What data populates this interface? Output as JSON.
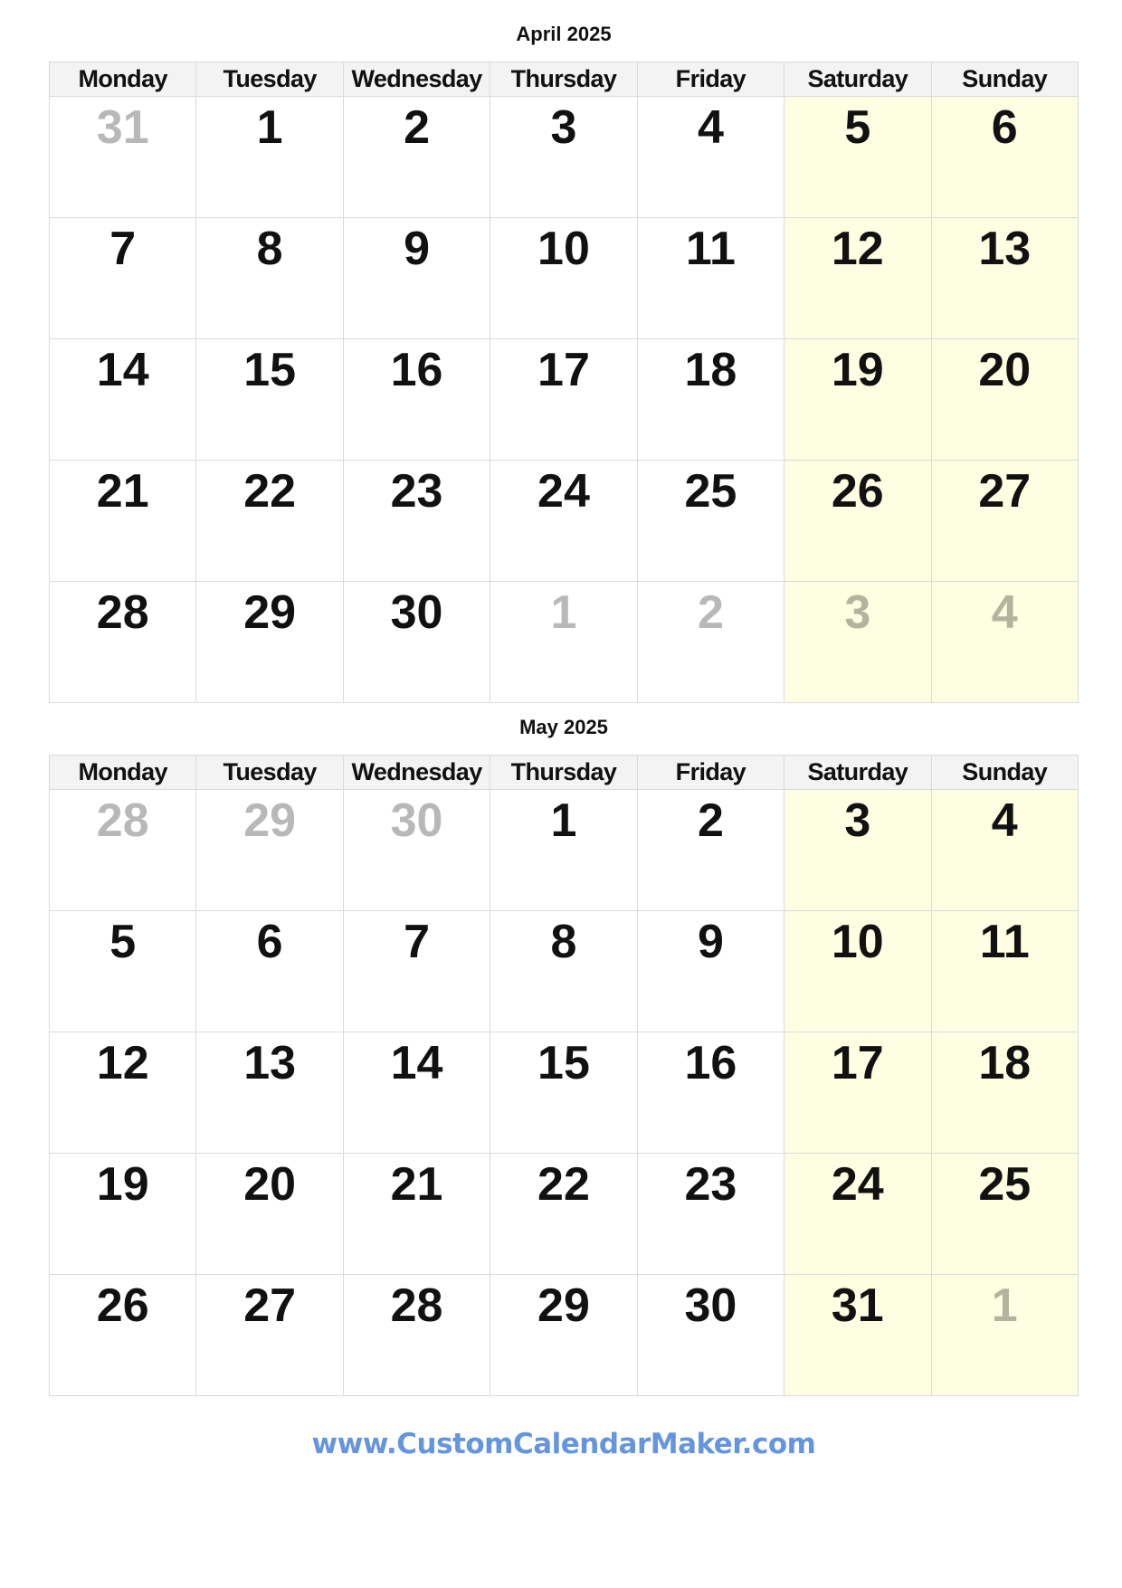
{
  "calendars": [
    {
      "title": "April 2025",
      "weekdays": [
        "Monday",
        "Tuesday",
        "Wednesday",
        "Thursday",
        "Friday",
        "Saturday",
        "Sunday"
      ],
      "weeks": [
        [
          {
            "day": "31",
            "other": true
          },
          {
            "day": "1"
          },
          {
            "day": "2"
          },
          {
            "day": "3"
          },
          {
            "day": "4"
          },
          {
            "day": "5"
          },
          {
            "day": "6"
          }
        ],
        [
          {
            "day": "7"
          },
          {
            "day": "8"
          },
          {
            "day": "9"
          },
          {
            "day": "10"
          },
          {
            "day": "11"
          },
          {
            "day": "12"
          },
          {
            "day": "13"
          }
        ],
        [
          {
            "day": "14"
          },
          {
            "day": "15"
          },
          {
            "day": "16"
          },
          {
            "day": "17"
          },
          {
            "day": "18"
          },
          {
            "day": "19"
          },
          {
            "day": "20"
          }
        ],
        [
          {
            "day": "21"
          },
          {
            "day": "22"
          },
          {
            "day": "23"
          },
          {
            "day": "24"
          },
          {
            "day": "25"
          },
          {
            "day": "26"
          },
          {
            "day": "27"
          }
        ],
        [
          {
            "day": "28"
          },
          {
            "day": "29"
          },
          {
            "day": "30"
          },
          {
            "day": "1",
            "other": true
          },
          {
            "day": "2",
            "other": true
          },
          {
            "day": "3",
            "other": true
          },
          {
            "day": "4",
            "other": true
          }
        ]
      ]
    },
    {
      "title": "May 2025",
      "weekdays": [
        "Monday",
        "Tuesday",
        "Wednesday",
        "Thursday",
        "Friday",
        "Saturday",
        "Sunday"
      ],
      "weeks": [
        [
          {
            "day": "28",
            "other": true
          },
          {
            "day": "29",
            "other": true
          },
          {
            "day": "30",
            "other": true
          },
          {
            "day": "1"
          },
          {
            "day": "2"
          },
          {
            "day": "3"
          },
          {
            "day": "4"
          }
        ],
        [
          {
            "day": "5"
          },
          {
            "day": "6"
          },
          {
            "day": "7"
          },
          {
            "day": "8"
          },
          {
            "day": "9"
          },
          {
            "day": "10"
          },
          {
            "day": "11"
          }
        ],
        [
          {
            "day": "12"
          },
          {
            "day": "13"
          },
          {
            "day": "14"
          },
          {
            "day": "15"
          },
          {
            "day": "16"
          },
          {
            "day": "17"
          },
          {
            "day": "18"
          }
        ],
        [
          {
            "day": "19"
          },
          {
            "day": "20"
          },
          {
            "day": "21"
          },
          {
            "day": "22"
          },
          {
            "day": "23"
          },
          {
            "day": "24"
          },
          {
            "day": "25"
          }
        ],
        [
          {
            "day": "26"
          },
          {
            "day": "27"
          },
          {
            "day": "28"
          },
          {
            "day": "29"
          },
          {
            "day": "30"
          },
          {
            "day": "31"
          },
          {
            "day": "1",
            "other": true
          }
        ]
      ]
    }
  ],
  "weekend_columns": [
    5,
    6
  ],
  "colors": {
    "weekend_background": "#fefee2",
    "header_background": "#f3f3f3",
    "other_month_text": "#b8b8b8",
    "grid_line": "#dadada",
    "watermark": "#6595dd"
  },
  "watermark": "www.CustomCalendarMaker.com"
}
